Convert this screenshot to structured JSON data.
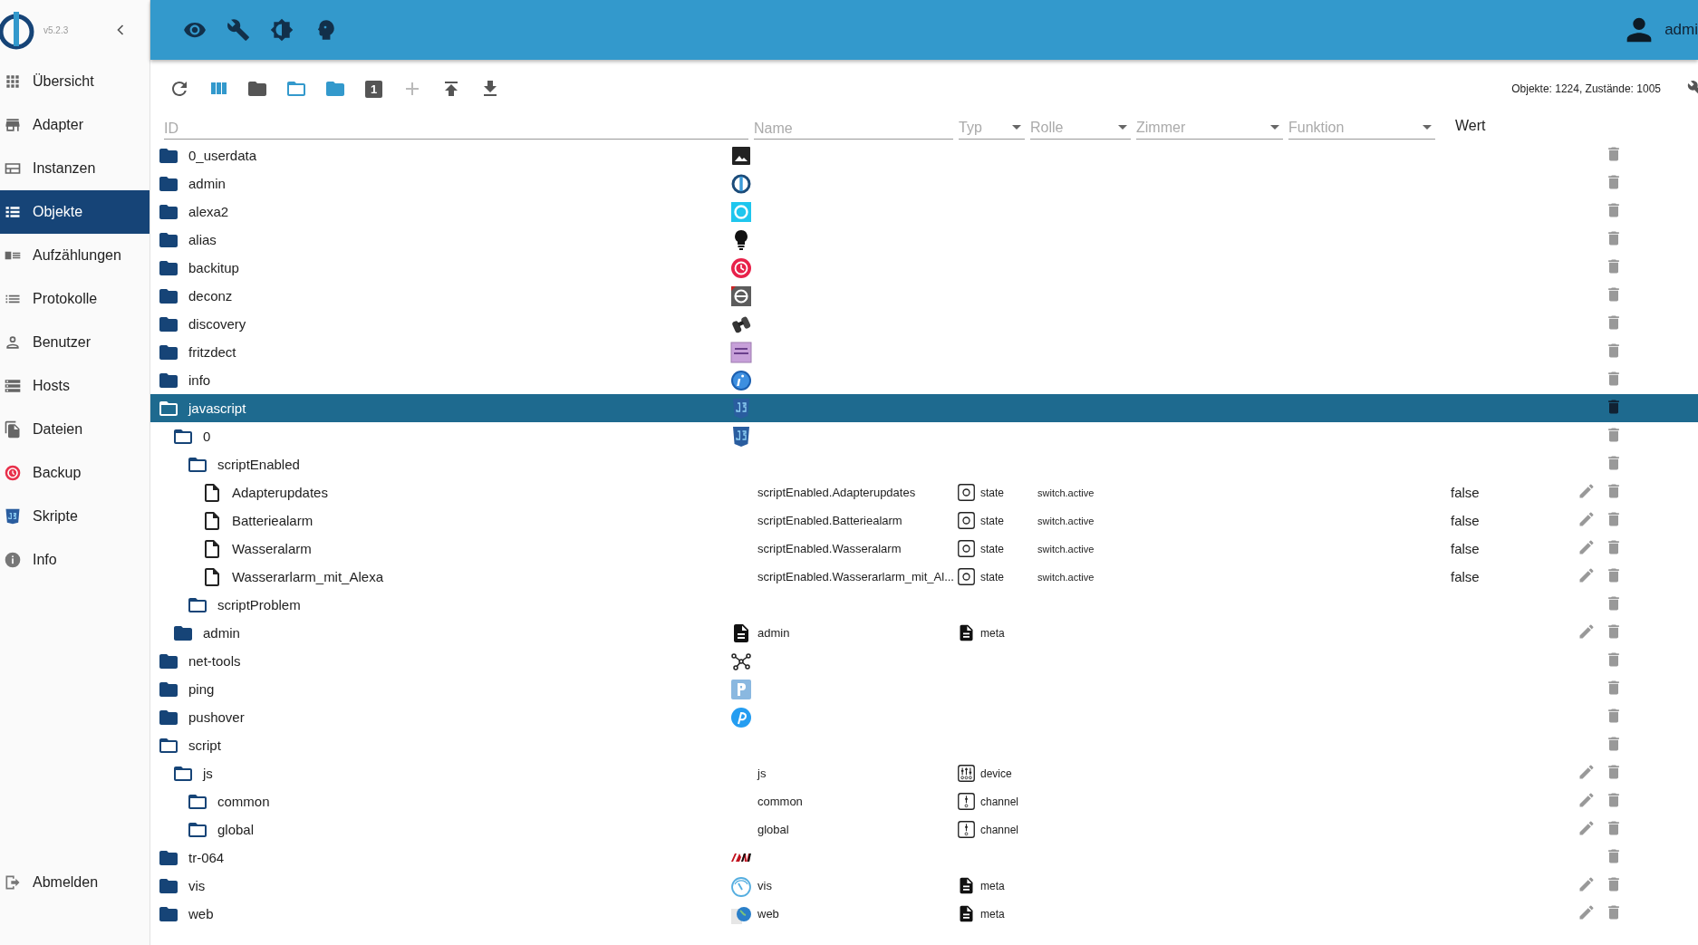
{
  "sidebar": {
    "version": "v5.2.3",
    "items": [
      {
        "label": "Übersicht",
        "selected": false
      },
      {
        "label": "Adapter",
        "selected": false
      },
      {
        "label": "Instanzen",
        "selected": false
      },
      {
        "label": "Objekte",
        "selected": true
      },
      {
        "label": "Aufzählungen",
        "selected": false
      },
      {
        "label": "Protokolle",
        "selected": false
      },
      {
        "label": "Benutzer",
        "selected": false
      },
      {
        "label": "Hosts",
        "selected": false
      },
      {
        "label": "Dateien",
        "selected": false
      },
      {
        "label": "Backup",
        "selected": false
      },
      {
        "label": "Skripte",
        "selected": false
      },
      {
        "label": "Info",
        "selected": false
      }
    ],
    "logout": "Abmelden"
  },
  "header": {
    "user": "admi"
  },
  "toolbar": [
    {
      "kind": "refresh",
      "on": false,
      "disabled": false
    },
    {
      "kind": "columns",
      "on": true,
      "disabled": false
    },
    {
      "kind": "folder",
      "on": false,
      "disabled": false
    },
    {
      "kind": "folder-open",
      "on": true,
      "disabled": false
    },
    {
      "kind": "folder",
      "on": true,
      "disabled": false
    },
    {
      "kind": "number",
      "on": false,
      "disabled": false,
      "label": "1"
    },
    {
      "kind": "add",
      "on": false,
      "disabled": true
    },
    {
      "kind": "upload",
      "on": false,
      "disabled": false
    },
    {
      "kind": "download",
      "on": false,
      "disabled": false
    }
  ],
  "status": "Objekte: 1224, Zustände: 1005",
  "filters": {
    "id": {
      "placeholder": "ID"
    },
    "name": {
      "placeholder": "Name"
    },
    "type": {
      "placeholder": "Typ"
    },
    "role": {
      "placeholder": "Rolle"
    },
    "room": {
      "placeholder": "Zimmer"
    },
    "function": {
      "placeholder": "Funktion"
    },
    "value_header": "Wert"
  },
  "tree": [
    {
      "label": "0_userdata",
      "kind": "folder",
      "expanded": false,
      "selected": false
    },
    {
      "label": "admin",
      "kind": "folder",
      "expanded": false,
      "selected": false
    },
    {
      "label": "alexa2",
      "kind": "folder",
      "expanded": false,
      "selected": false
    },
    {
      "label": "alias",
      "kind": "folder",
      "expanded": false,
      "selected": false
    },
    {
      "label": "backitup",
      "kind": "folder",
      "expanded": false,
      "selected": false
    },
    {
      "label": "deconz",
      "kind": "folder",
      "expanded": false,
      "selected": false
    },
    {
      "label": "discovery",
      "kind": "folder",
      "expanded": false,
      "selected": false
    },
    {
      "label": "fritzdect",
      "kind": "folder",
      "expanded": false,
      "selected": false
    },
    {
      "label": "info",
      "kind": "folder",
      "expanded": false,
      "selected": false
    },
    {
      "label": "javascript",
      "kind": "folder",
      "expanded": true,
      "selected": true,
      "children": [
        {
          "label": "0",
          "kind": "folder",
          "expanded": true,
          "selected": false,
          "children": [
            {
              "label": "scriptEnabled",
              "kind": "folder",
              "expanded": true,
              "selected": false,
              "children": [
                {
                  "label": "Adapterupdates",
                  "kind": "state",
                  "selected": false,
                  "name": "scriptEnabled.Adapterupdates",
                  "type": "state",
                  "role": "switch.active",
                  "value": "false",
                  "editable": true
                },
                {
                  "label": "Batteriealarm",
                  "kind": "state",
                  "selected": false,
                  "name": "scriptEnabled.Batteriealarm",
                  "type": "state",
                  "role": "switch.active",
                  "value": "false",
                  "editable": true
                },
                {
                  "label": "Wasseralarm",
                  "kind": "state",
                  "selected": false,
                  "name": "scriptEnabled.Wasseralarm",
                  "type": "state",
                  "role": "switch.active",
                  "value": "false",
                  "editable": true
                },
                {
                  "label": "Wasserarlarm_mit_Alexa",
                  "kind": "state",
                  "selected": false,
                  "name": "scriptEnabled.Wasserarlarm_mit_Al...",
                  "type": "state",
                  "role": "switch.active",
                  "value": "false",
                  "editable": true
                }
              ]
            },
            {
              "label": "scriptProblem",
              "kind": "folder",
              "expanded": true,
              "selected": false
            }
          ]
        },
        {
          "label": "admin",
          "kind": "folder",
          "expanded": false,
          "selected": false,
          "name": "admin",
          "type": "meta",
          "editable": true
        }
      ]
    },
    {
      "label": "net-tools",
      "kind": "folder",
      "expanded": false,
      "selected": false
    },
    {
      "label": "ping",
      "kind": "folder",
      "expanded": false,
      "selected": false
    },
    {
      "label": "pushover",
      "kind": "folder",
      "expanded": false,
      "selected": false
    },
    {
      "label": "script",
      "kind": "folder",
      "expanded": true,
      "selected": false,
      "children": [
        {
          "label": "js",
          "kind": "folder",
          "expanded": true,
          "selected": false,
          "name": "js",
          "type": "device",
          "editable": true,
          "children": [
            {
              "label": "common",
              "kind": "folder",
              "expanded": true,
              "selected": false,
              "name": "common",
              "type": "channel",
              "editable": true
            },
            {
              "label": "global",
              "kind": "folder",
              "expanded": true,
              "selected": false,
              "name": "global",
              "type": "channel",
              "editable": true
            }
          ]
        }
      ]
    },
    {
      "label": "tr-064",
      "kind": "folder",
      "expanded": false,
      "selected": false
    },
    {
      "label": "vis",
      "kind": "folder",
      "expanded": false,
      "selected": false,
      "name": "vis",
      "type": "meta",
      "editable": true
    },
    {
      "label": "web",
      "kind": "folder",
      "expanded": false,
      "selected": false,
      "name": "web",
      "type": "meta",
      "editable": true
    }
  ]
}
